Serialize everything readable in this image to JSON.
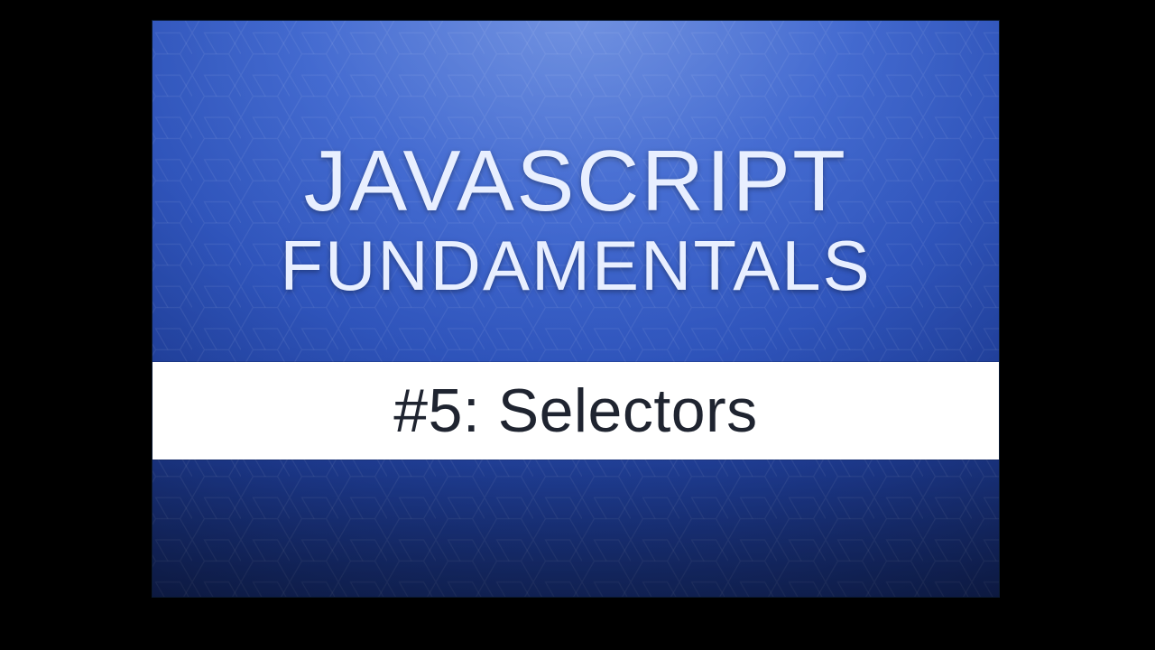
{
  "title": {
    "line1": "JAVASCRIPT",
    "line2": "FUNDAMENTALS"
  },
  "subtitle": "#5: Selectors",
  "colors": {
    "panel_top": "#4d76d9",
    "panel_bottom": "#0a1636",
    "subtitle_bg": "#ffffff",
    "subtitle_text": "#1f2430",
    "title_text": "#e8efff"
  }
}
